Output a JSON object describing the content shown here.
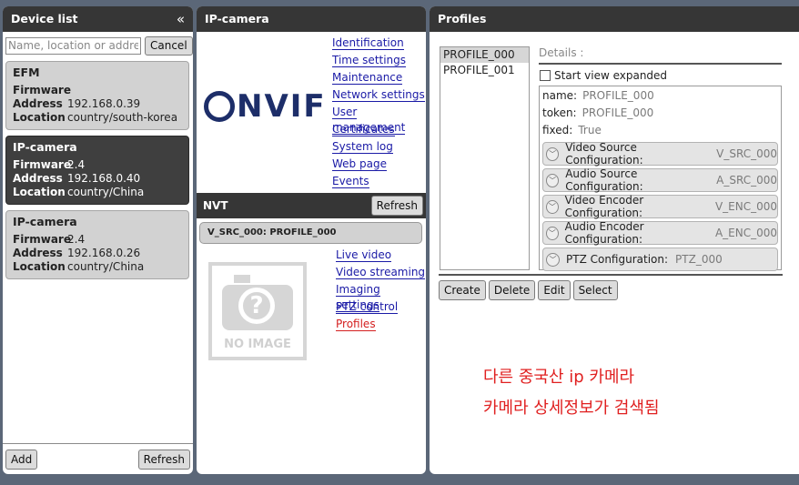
{
  "device_list": {
    "title": "Device list",
    "collapse_icon": "«",
    "search_placeholder": "Name, location or address",
    "cancel_label": "Cancel",
    "field_labels": {
      "firmware": "Firmware",
      "address": "Address",
      "location": "Location"
    },
    "devices": [
      {
        "name": "EFM",
        "firmware": "",
        "address": "192.168.0.39",
        "location": "country/south-korea",
        "selected": false
      },
      {
        "name": "IP-camera",
        "firmware": "2.4",
        "address": "192.168.0.40",
        "location": "country/China",
        "selected": true
      },
      {
        "name": "IP-camera",
        "firmware": "2.4",
        "address": "192.168.0.26",
        "location": "country/China",
        "selected": false
      }
    ],
    "add_label": "Add",
    "refresh_label": "Refresh"
  },
  "camera": {
    "title": "IP-camera",
    "logo_text": "NVIF",
    "links": [
      "Identification",
      "Time settings",
      "Maintenance",
      "Network settings",
      "User management",
      "Certificates",
      "System log",
      "Web page",
      "Events"
    ],
    "nvt": {
      "title": "NVT",
      "refresh_label": "Refresh",
      "profile_label": "V_SRC_000: PROFILE_000",
      "no_image_text": "NO IMAGE",
      "links": [
        "Live video",
        "Video streaming",
        "Imaging settings",
        "PTZ control",
        "Profiles"
      ],
      "active_link": "Profiles"
    }
  },
  "profiles": {
    "title": "Profiles",
    "items": [
      "PROFILE_000",
      "PROFILE_001"
    ],
    "selected": "PROFILE_000",
    "details_label": "Details :",
    "start_view_label": "Start view expanded",
    "fields": [
      {
        "key": "name:",
        "value": "PROFILE_000"
      },
      {
        "key": "token:",
        "value": "PROFILE_000"
      },
      {
        "key": "fixed:",
        "value": "True"
      }
    ],
    "configs": [
      {
        "label": "Video Source Configuration:",
        "value": "V_SRC_000"
      },
      {
        "label": "Audio Source Configuration:",
        "value": "A_SRC_000"
      },
      {
        "label": "Video Encoder Configuration:",
        "value": "V_ENC_000"
      },
      {
        "label": "Audio Encoder Configuration:",
        "value": "A_ENC_000"
      },
      {
        "label": "PTZ Configuration:",
        "value": "PTZ_000"
      }
    ],
    "actions": [
      "Create",
      "Delete",
      "Edit",
      "Select"
    ],
    "annotation": [
      "다른 중국산 ip 카메라",
      "카메라 상세정보가 검색됨"
    ],
    "annotation_color": "#e02020"
  }
}
